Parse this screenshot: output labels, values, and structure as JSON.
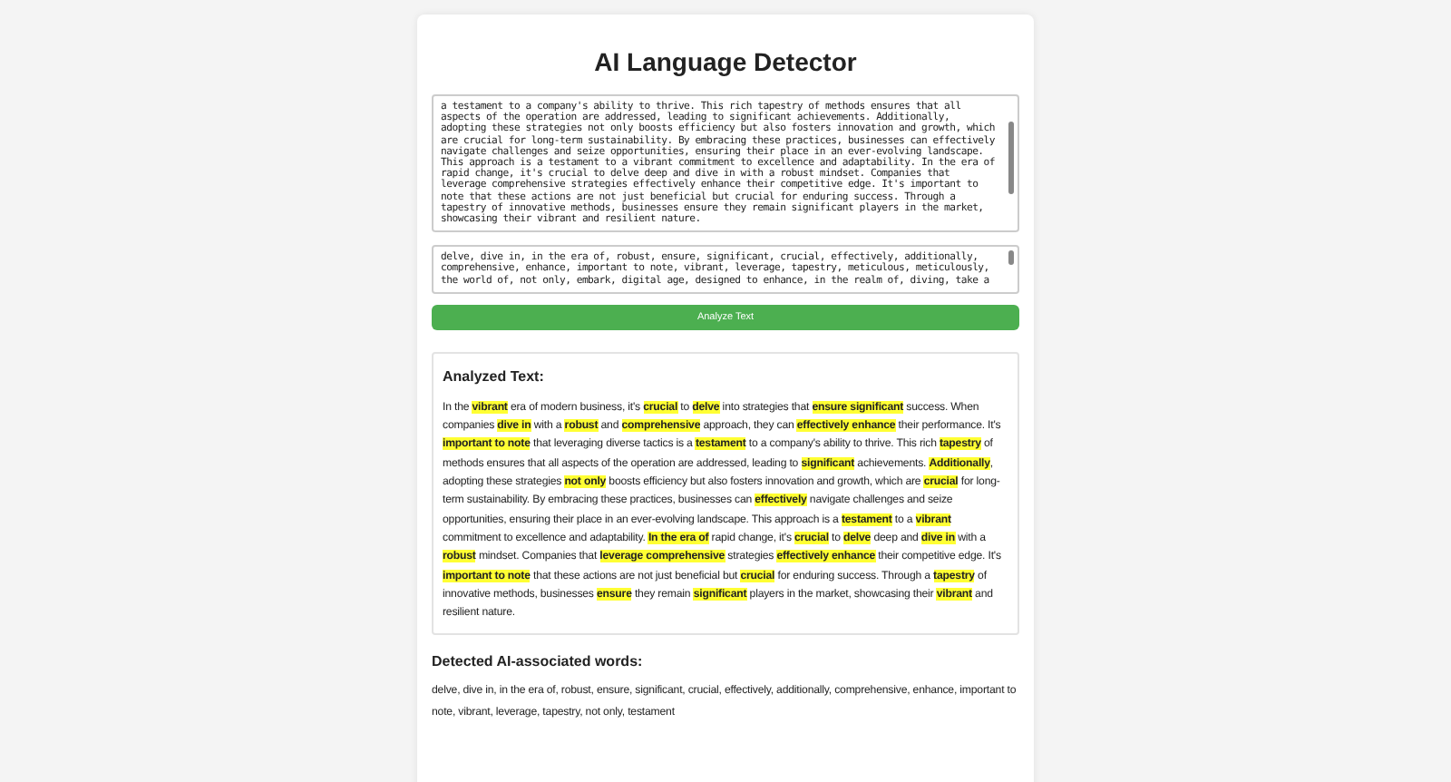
{
  "title": "AI Language Detector",
  "input_text": {
    "value": "a testament to a company's ability to thrive. This rich tapestry of methods ensures that all aspects of the operation are addressed, leading to significant achievements. Additionally, adopting these strategies not only boosts efficiency but also fosters innovation and growth, which are crucial for long-term sustainability. By embracing these practices, businesses can effectively navigate challenges and seize opportunities, ensuring their place in an ever-evolving landscape. This approach is a testament to a vibrant commitment to excellence and adaptability. In the era of rapid change, it's crucial to delve deep and dive in with a robust mindset. Companies that leverage comprehensive strategies effectively enhance their competitive edge. It's important to note that these actions are not just beneficial but crucial for enduring success. Through a tapestry of innovative methods, businesses ensure they remain significant players in the market, showcasing their vibrant and resilient nature."
  },
  "word_list": {
    "value": "delve, dive in, in the era of, robust, ensure, significant, crucial, effectively, additionally, comprehensive, enhance, important to note, vibrant, leverage, tapestry, meticulous, meticulously, the world of, not only, embark, digital age, designed to enhance, in the realm of, diving, take a"
  },
  "analyze_button": "Analyze Text",
  "analyzed": {
    "heading": "Analyzed Text:",
    "segments": [
      {
        "text": "In the ",
        "highlighted": false
      },
      {
        "text": "vibrant",
        "highlighted": true
      },
      {
        "text": " era of modern business, it's ",
        "highlighted": false
      },
      {
        "text": "crucial",
        "highlighted": true
      },
      {
        "text": " to ",
        "highlighted": false
      },
      {
        "text": "delve",
        "highlighted": true
      },
      {
        "text": " into strategies that ",
        "highlighted": false
      },
      {
        "text": "ensure significant",
        "highlighted": true
      },
      {
        "text": " success. When companies ",
        "highlighted": false
      },
      {
        "text": "dive in",
        "highlighted": true
      },
      {
        "text": " with a ",
        "highlighted": false
      },
      {
        "text": "robust",
        "highlighted": true
      },
      {
        "text": " and ",
        "highlighted": false
      },
      {
        "text": "comprehensive",
        "highlighted": true
      },
      {
        "text": " approach, they can ",
        "highlighted": false
      },
      {
        "text": "effectively enhance",
        "highlighted": true
      },
      {
        "text": " their performance. It's ",
        "highlighted": false
      },
      {
        "text": "important to note",
        "highlighted": true
      },
      {
        "text": " that leveraging diverse tactics is a ",
        "highlighted": false
      },
      {
        "text": "testament",
        "highlighted": true
      },
      {
        "text": " to a company's ability to thrive. This rich ",
        "highlighted": false
      },
      {
        "text": "tapestry",
        "highlighted": true
      },
      {
        "text": " of methods ensures that all aspects of the operation are addressed, leading to ",
        "highlighted": false
      },
      {
        "text": "significant",
        "highlighted": true
      },
      {
        "text": " achievements. ",
        "highlighted": false
      },
      {
        "text": "Additionally",
        "highlighted": true
      },
      {
        "text": ", adopting these strategies ",
        "highlighted": false
      },
      {
        "text": "not only",
        "highlighted": true
      },
      {
        "text": " boosts efficiency but also fosters innovation and growth, which are ",
        "highlighted": false
      },
      {
        "text": "crucial",
        "highlighted": true
      },
      {
        "text": " for long-term sustainability. By embracing these practices, businesses can ",
        "highlighted": false
      },
      {
        "text": "effectively",
        "highlighted": true
      },
      {
        "text": " navigate challenges and seize opportunities, ensuring their place in an ever-evolving landscape. This approach is a ",
        "highlighted": false
      },
      {
        "text": "testament",
        "highlighted": true
      },
      {
        "text": " to a ",
        "highlighted": false
      },
      {
        "text": "vibrant",
        "highlighted": true
      },
      {
        "text": " commitment to excellence and adaptability. ",
        "highlighted": false
      },
      {
        "text": "In the era of",
        "highlighted": true
      },
      {
        "text": " rapid change, it's ",
        "highlighted": false
      },
      {
        "text": "crucial",
        "highlighted": true
      },
      {
        "text": " to ",
        "highlighted": false
      },
      {
        "text": "delve",
        "highlighted": true
      },
      {
        "text": " deep and ",
        "highlighted": false
      },
      {
        "text": "dive in",
        "highlighted": true
      },
      {
        "text": " with a ",
        "highlighted": false
      },
      {
        "text": "robust",
        "highlighted": true
      },
      {
        "text": " mindset. Companies that ",
        "highlighted": false
      },
      {
        "text": "leverage comprehensive",
        "highlighted": true
      },
      {
        "text": " strategies ",
        "highlighted": false
      },
      {
        "text": "effectively enhance",
        "highlighted": true
      },
      {
        "text": " their competitive edge. It's ",
        "highlighted": false
      },
      {
        "text": "important to note",
        "highlighted": true
      },
      {
        "text": " that these actions are not just beneficial but ",
        "highlighted": false
      },
      {
        "text": "crucial",
        "highlighted": true
      },
      {
        "text": " for enduring success. Through a ",
        "highlighted": false
      },
      {
        "text": "tapestry",
        "highlighted": true
      },
      {
        "text": " of innovative methods, businesses ",
        "highlighted": false
      },
      {
        "text": "ensure",
        "highlighted": true
      },
      {
        "text": " they remain ",
        "highlighted": false
      },
      {
        "text": "significant",
        "highlighted": true
      },
      {
        "text": " players in the market, showcasing their ",
        "highlighted": false
      },
      {
        "text": "vibrant",
        "highlighted": true
      },
      {
        "text": " and resilient nature.",
        "highlighted": false
      }
    ]
  },
  "detected": {
    "heading": "Detected AI-associated words:",
    "words": "delve, dive in, in the era of, robust, ensure, significant, crucial, effectively, additionally, comprehensive, enhance, important to note, vibrant, leverage, tapestry, not only, testament"
  }
}
